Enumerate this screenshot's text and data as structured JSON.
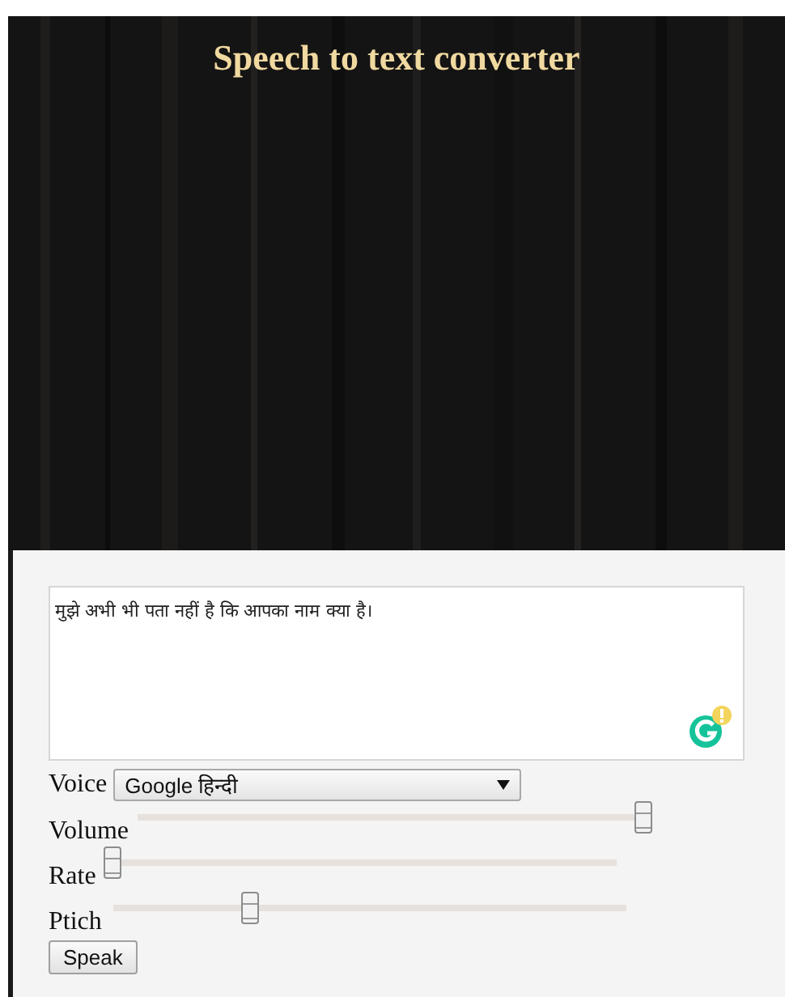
{
  "header": {
    "title": "Speech to text converter"
  },
  "text_area": {
    "value": "मुझे अभी भी पता नहीं है कि आपका नाम क्या है।"
  },
  "voice": {
    "label": "Voice",
    "value": "Google हिन्दी"
  },
  "sliders": [
    {
      "label": "Volume",
      "level": 1.0
    },
    {
      "label": "Rate",
      "level": 0.0
    },
    {
      "label": "Ptich",
      "level": 0.26
    }
  ],
  "buttons": [
    {
      "label": "Speak"
    }
  ]
}
